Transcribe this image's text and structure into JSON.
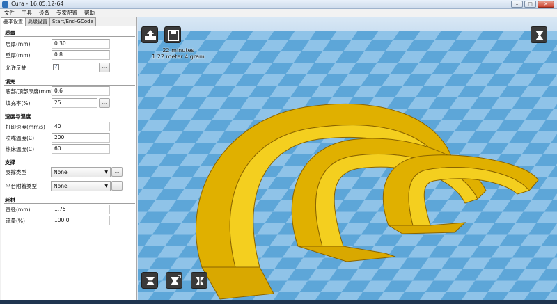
{
  "window": {
    "title": "Cura - 16.05.12-64",
    "minimize": "–",
    "maximize": "□",
    "close": "✕"
  },
  "menu": {
    "items": [
      "文件",
      "工具",
      "设备",
      "专家配置",
      "帮助"
    ]
  },
  "tabs": [
    "基本设置",
    "高级设置",
    "Start/End-GCode"
  ],
  "sections": {
    "quality": "质量",
    "fill": "填充",
    "speed_temp": "速度与温度",
    "support": "支撑",
    "filament": "耗材"
  },
  "fields": {
    "layer_height": {
      "label": "层厚(mm)",
      "value": "0.30"
    },
    "wall_thickness": {
      "label": "壁厚(mm)",
      "value": "0.8"
    },
    "retraction": {
      "label": "允许反抽",
      "checked": "✓",
      "button": "..."
    },
    "top_bottom": {
      "label": "底部/顶部厚度(mm)",
      "value": "0.6"
    },
    "fill_density": {
      "label": "填充率(%)",
      "value": "25",
      "button": "..."
    },
    "print_speed": {
      "label": "打印速度(mm/s)",
      "value": "40"
    },
    "nozzle_temp": {
      "label": "喷嘴温度(C)",
      "value": "200"
    },
    "bed_temp": {
      "label": "热床温度(C)",
      "value": "60"
    },
    "support_type": {
      "label": "支撑类型",
      "value": "None",
      "arrow": "▼",
      "button": "..."
    },
    "platform_adhesion": {
      "label": "平台附着类型",
      "value": "None",
      "arrow": "▼",
      "button": "..."
    },
    "diameter": {
      "label": "直径(mm)",
      "value": "1.75"
    },
    "flow": {
      "label": "流量(%)",
      "value": "100.0"
    }
  },
  "print_info": {
    "time": "22 minutes",
    "material": "1.22 meter 4 gram"
  },
  "icons": {
    "load": "load-model-icon",
    "save": "save-toolpath-icon",
    "view_mode": "view-mode-icon",
    "rotate": "rotate-icon",
    "scale": "scale-icon",
    "mirror": "mirror-icon"
  },
  "colors": {
    "model": "#f2c20a",
    "model_shade": "#b88a00",
    "floor_a": "#8fc3e8",
    "floor_b": "#5da6d8"
  }
}
